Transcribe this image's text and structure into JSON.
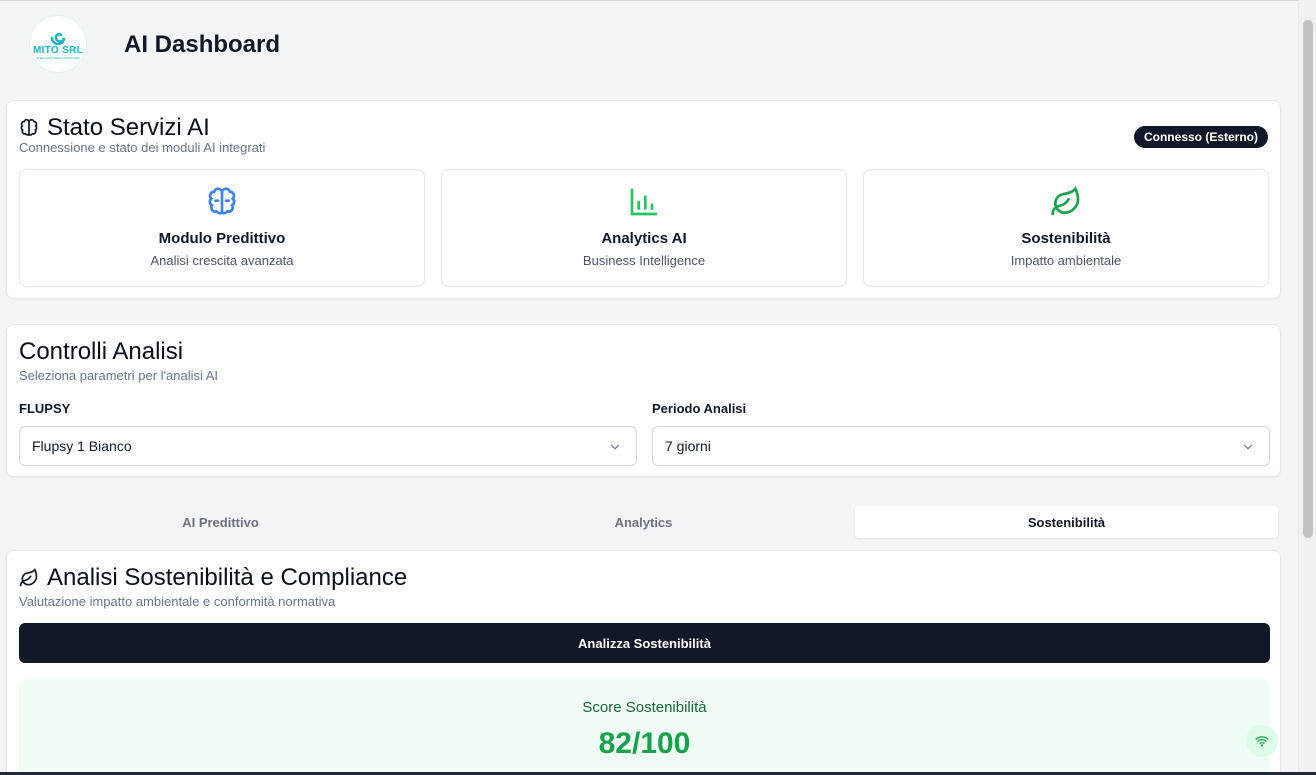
{
  "header": {
    "logo_text": "MITO SRL",
    "logo_tagline": "SHELLFISH SEED PRODUCER",
    "title": "AI Dashboard"
  },
  "services": {
    "title": "Stato Servizi AI",
    "subtitle": "Connessione e stato dei moduli AI integrati",
    "status_badge": "Connesso (Esterno)",
    "modules": [
      {
        "icon": "brain-icon",
        "title": "Modulo Predittivo",
        "subtitle": "Analisi crescita avanzata",
        "color": "#3b82f6"
      },
      {
        "icon": "bar-chart-icon",
        "title": "Analytics AI",
        "subtitle": "Business Intelligence",
        "color": "#22c55e"
      },
      {
        "icon": "leaf-icon",
        "title": "Sostenibilità",
        "subtitle": "Impatto ambientale",
        "color": "#16a34a"
      }
    ]
  },
  "controls": {
    "title": "Controlli Analisi",
    "subtitle": "Seleziona parametri per l'analisi AI",
    "flupsy_label": "FLUPSY",
    "flupsy_value": "Flupsy 1 Bianco",
    "period_label": "Periodo Analisi",
    "period_value": "7 giorni"
  },
  "tabs": [
    {
      "label": "AI Predittivo",
      "active": false
    },
    {
      "label": "Analytics",
      "active": false
    },
    {
      "label": "Sostenibilità",
      "active": true
    }
  ],
  "sustainability": {
    "title": "Analisi Sostenibilità e Compliance",
    "subtitle": "Valutazione impatto ambientale e conformità normativa",
    "button_label": "Analizza Sostenibilità",
    "score_label": "Score Sostenibilità",
    "score_value": "82/100"
  },
  "colors": {
    "primary": "#111827",
    "accent_green": "#16a34a",
    "accent_blue": "#3b82f6",
    "brand_teal": "#16b5bf"
  }
}
